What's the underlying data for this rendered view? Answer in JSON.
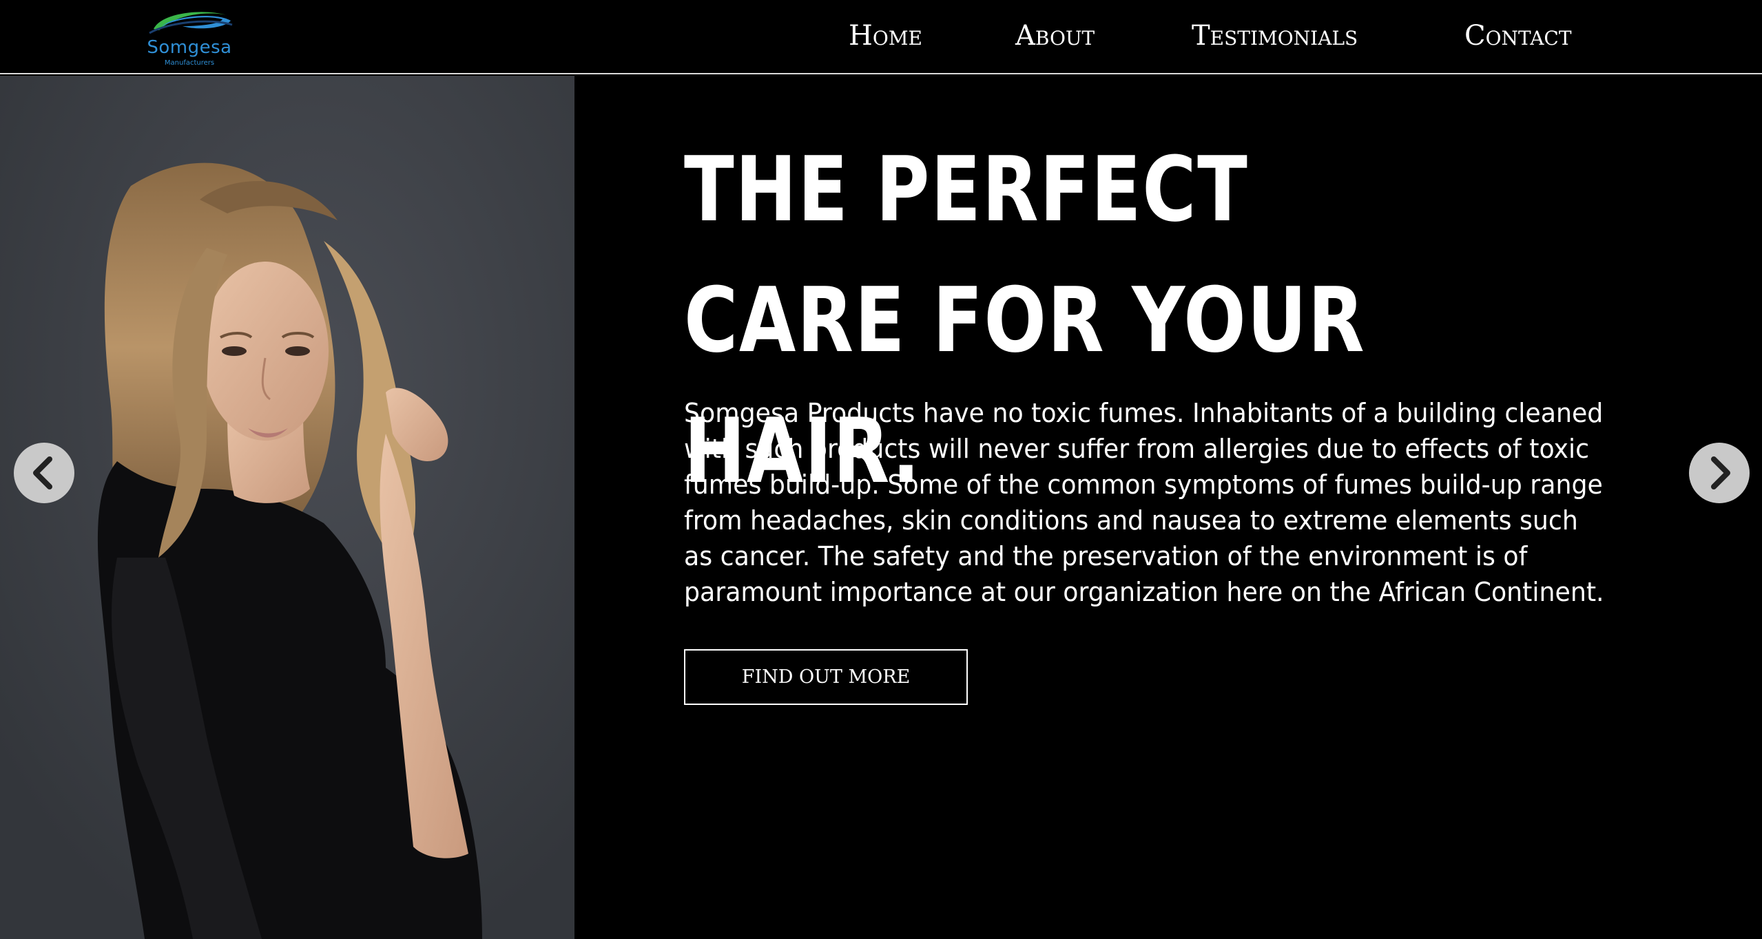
{
  "brand": {
    "name": "Somgesa",
    "tagline": "Manufacturers"
  },
  "nav": {
    "home": "Home",
    "about": "About",
    "testimonials": "Testimonials",
    "contact": "Contact"
  },
  "hero": {
    "headline": "THE PERFECT CARE FOR YOUR HAIR.",
    "body": "Somgesa Products have no toxic fumes. Inhabitants of a building cleaned with such products will never suffer from allergies due to effects of toxic fumes build-up. Some of the common symptoms of fumes build-up range from headaches, skin conditions and nausea to extreme elements such as cancer. The safety and the preservation of the environment is of paramount importance at our organization here on the African Continent.",
    "cta_label": "FIND OUT MORE"
  },
  "carousel": {
    "prev_icon": "chevron-left-icon",
    "next_icon": "chevron-right-icon"
  },
  "colors": {
    "background": "#000000",
    "text": "#ffffff",
    "logo_blue": "#2f8fd6",
    "logo_green": "#3bb54a",
    "arrow_bg": "#c9c9c9"
  }
}
